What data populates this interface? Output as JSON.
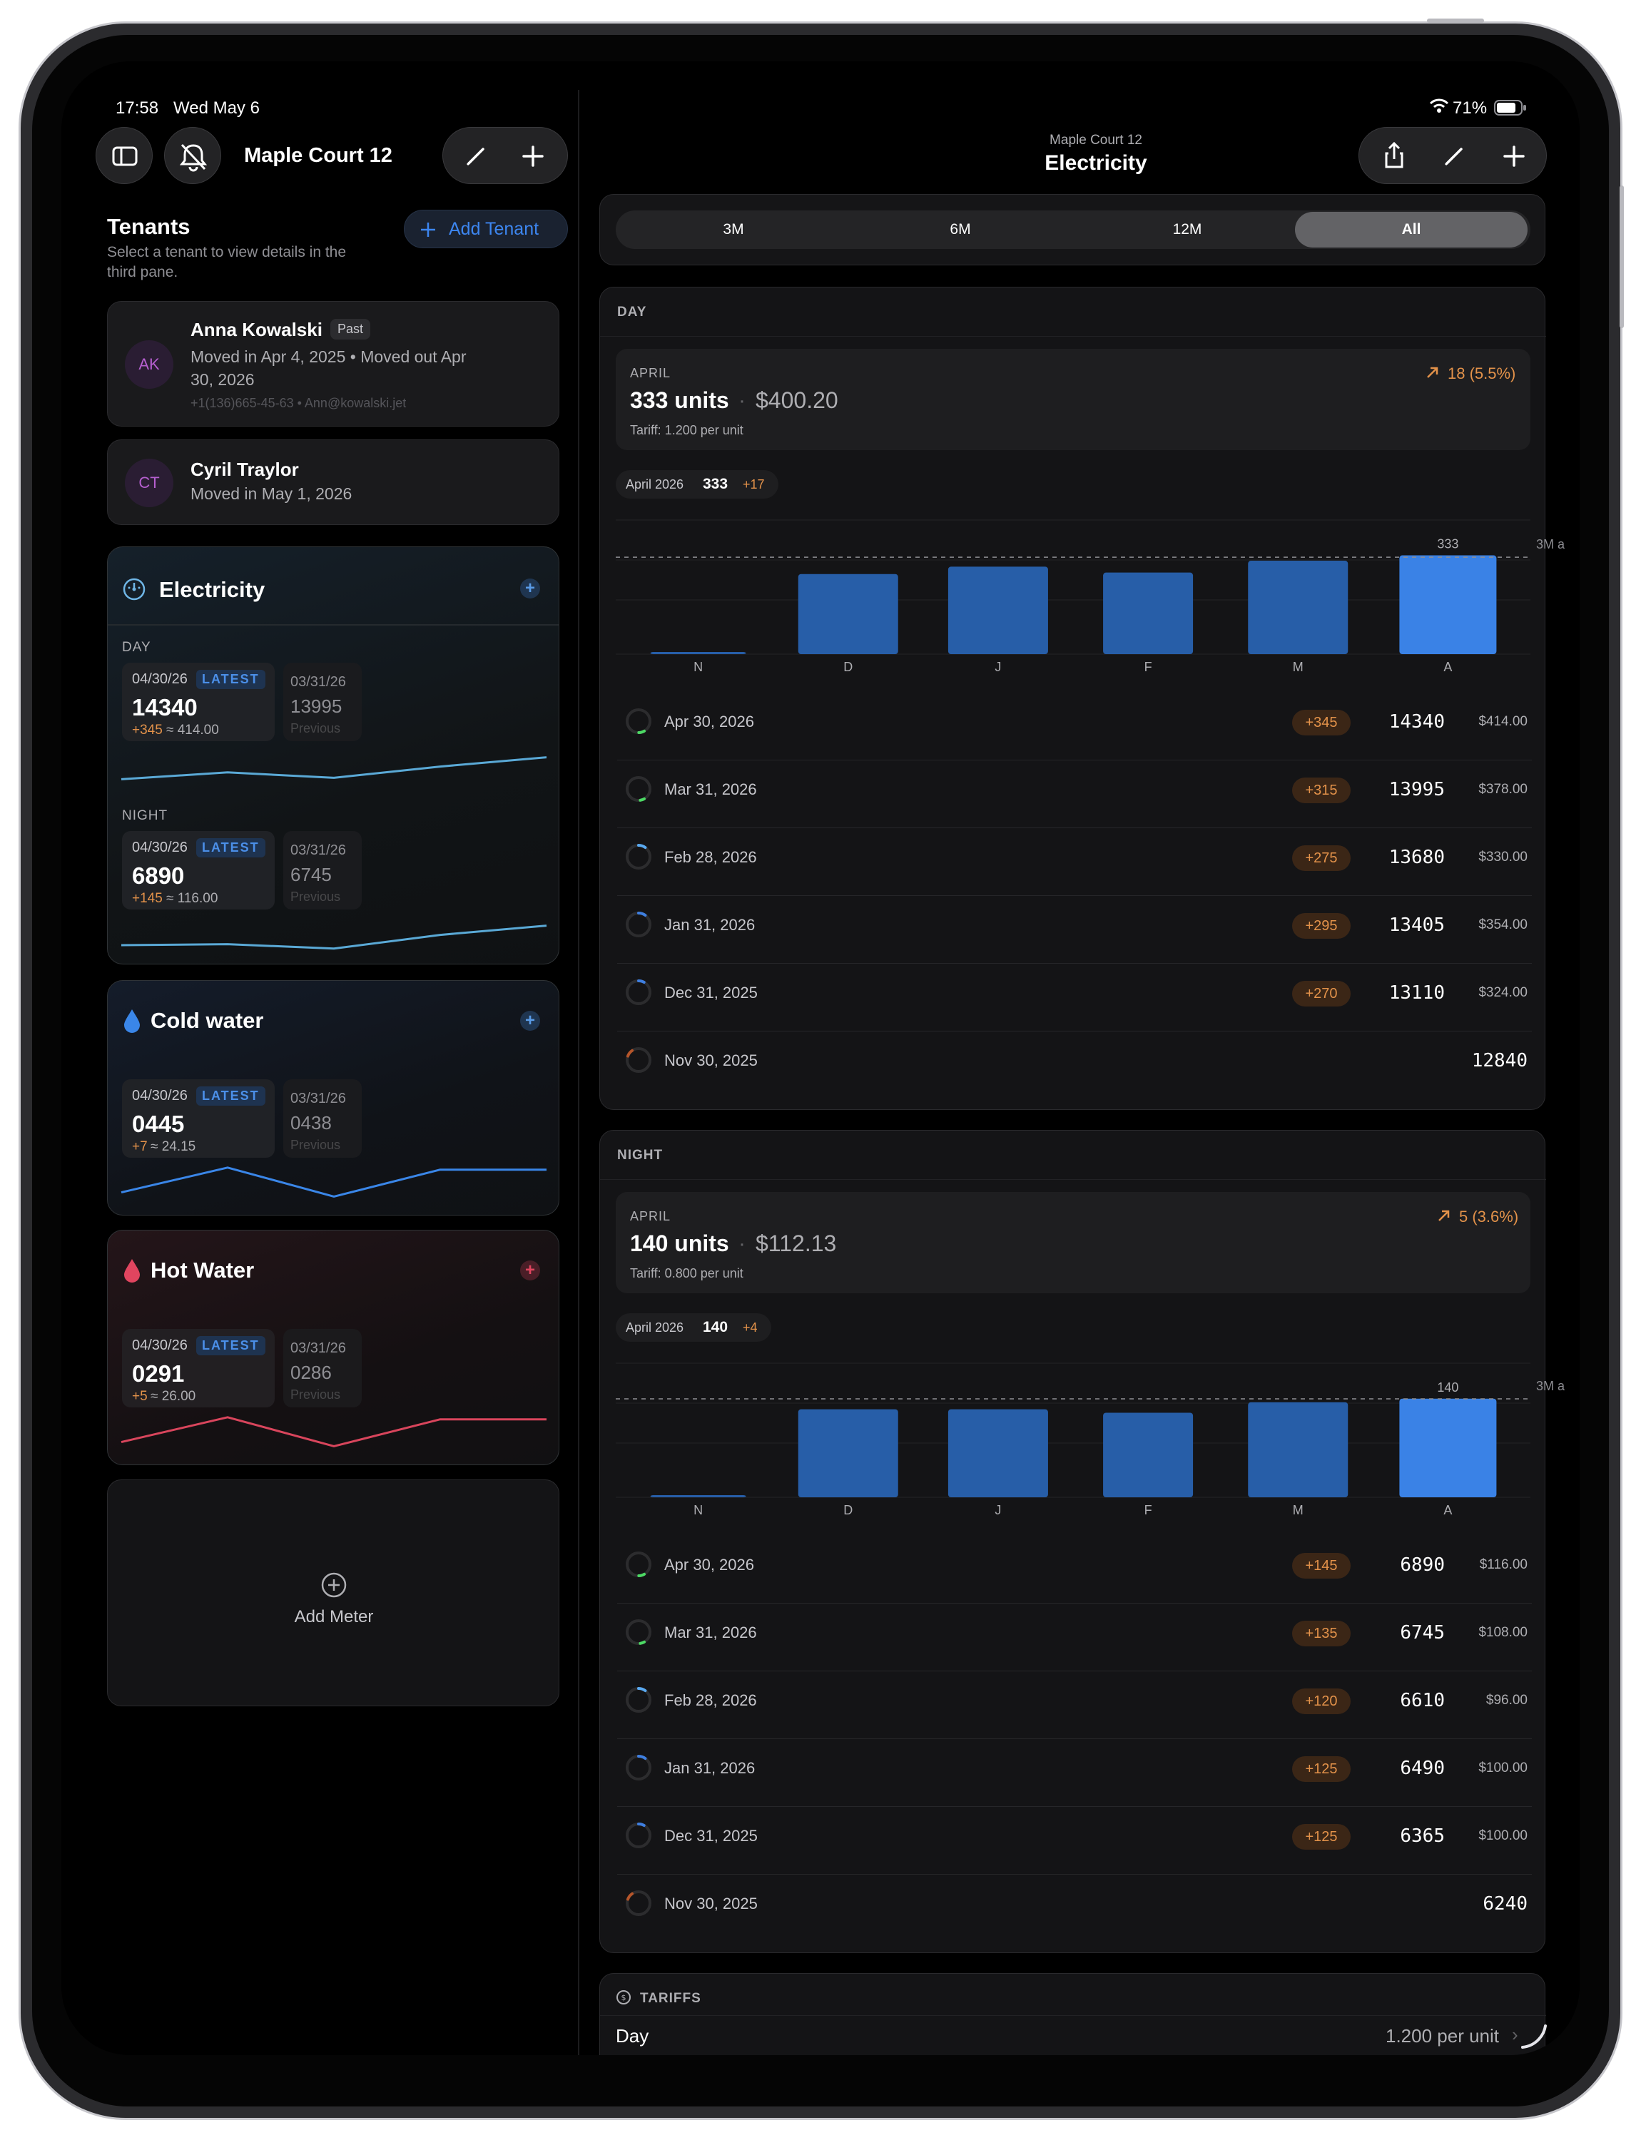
{
  "status_bar": {
    "time": "17:58",
    "date": "Wed May 6",
    "battery": "71%"
  },
  "left_toolbar": {
    "title": "Maple Court 12"
  },
  "tenants": {
    "heading": "Tenants",
    "subtitle_line1": "Select a tenant to view details in the",
    "subtitle_line2": "third pane.",
    "add_label": "Add Tenant",
    "items": [
      {
        "initials": "AK",
        "name": "Anna Kowalski",
        "badge": "Past",
        "line1": "Moved in Apr 4, 2025 • Moved out Apr",
        "line2": "30, 2026",
        "contact": "+1(136)665-45-63 • Ann@kowalski.jet"
      },
      {
        "initials": "CT",
        "name": "Cyril Traylor",
        "line1": "Moved in May 1, 2026"
      }
    ]
  },
  "meters": {
    "electricity": {
      "title": "Electricity",
      "day": {
        "label": "DAY",
        "latest_date": "04/30/26",
        "latest_tag": "LATEST",
        "latest_value": "14340",
        "latest_delta": "+345",
        "latest_cost": "≈ 414.00",
        "prev_date": "03/31/26",
        "prev_value": "13995",
        "prev_label": "Previous"
      },
      "night": {
        "label": "NIGHT",
        "latest_date": "04/30/26",
        "latest_tag": "LATEST",
        "latest_value": "6890",
        "latest_delta": "+145",
        "latest_cost": "≈ 116.00",
        "prev_date": "03/31/26",
        "prev_value": "6745",
        "prev_label": "Previous"
      }
    },
    "cold_water": {
      "title": "Cold water",
      "latest_date": "04/30/26",
      "latest_tag": "LATEST",
      "latest_value": "0445",
      "latest_delta": "+7",
      "latest_cost": "≈ 24.15",
      "prev_date": "03/31/26",
      "prev_value": "0438",
      "prev_label": "Previous"
    },
    "hot_water": {
      "title": "Hot Water",
      "latest_date": "04/30/26",
      "latest_tag": "LATEST",
      "latest_value": "0291",
      "latest_delta": "+5",
      "latest_cost": "≈ 26.00",
      "prev_date": "03/31/26",
      "prev_value": "0286",
      "prev_label": "Previous"
    },
    "add_meter_label": "Add Meter"
  },
  "detail_header": {
    "subtitle": "Maple Court 12",
    "title": "Electricity"
  },
  "range_selector": {
    "options": [
      "3M",
      "6M",
      "12M",
      "All"
    ],
    "selected": "All"
  },
  "day_section": {
    "label": "DAY",
    "summary": {
      "month": "APRIL",
      "units": "333 units",
      "dot": "·",
      "cost": "$400.20",
      "tariff": "Tariff: 1.200 per unit",
      "trend": "18 (5.5%)"
    },
    "chip": {
      "period": "April 2026",
      "value": "333",
      "delta": "+17"
    },
    "avg_label": "3M a",
    "rows": [
      {
        "date": "Apr 30, 2026",
        "delta": "+345",
        "value": "14340",
        "cost": "$414.00",
        "ring": 0.08,
        "ring_color": "#4cd964"
      },
      {
        "date": "Mar 31, 2026",
        "delta": "+315",
        "value": "13995",
        "cost": "$378.00",
        "ring": 0.06,
        "ring_color": "#4cd964"
      },
      {
        "date": "Feb 28, 2026",
        "delta": "+275",
        "value": "13680",
        "cost": "$330.00",
        "ring": 0.1,
        "ring_color": "#5aa9f0"
      },
      {
        "date": "Jan 31, 2026",
        "delta": "+295",
        "value": "13405",
        "cost": "$354.00",
        "ring": 0.1,
        "ring_color": "#3f7fe0"
      },
      {
        "date": "Dec 31, 2025",
        "delta": "+270",
        "value": "13110",
        "cost": "$324.00",
        "ring": 0.08,
        "ring_color": "#3f7fe0"
      },
      {
        "date": "Nov 30, 2025",
        "value": "12840",
        "ring": 0.1,
        "ring_color": "#b5552a"
      }
    ]
  },
  "night_section": {
    "label": "NIGHT",
    "summary": {
      "month": "APRIL",
      "units": "140 units",
      "dot": "·",
      "cost": "$112.13",
      "tariff": "Tariff: 0.800 per unit",
      "trend": "5 (3.6%)"
    },
    "chip": {
      "period": "April 2026",
      "value": "140",
      "delta": "+4"
    },
    "avg_label": "3M a",
    "rows": [
      {
        "date": "Apr 30, 2026",
        "delta": "+145",
        "value": "6890",
        "cost": "$116.00",
        "ring": 0.08,
        "ring_color": "#4cd964"
      },
      {
        "date": "Mar 31, 2026",
        "delta": "+135",
        "value": "6745",
        "cost": "$108.00",
        "ring": 0.06,
        "ring_color": "#4cd964"
      },
      {
        "date": "Feb 28, 2026",
        "delta": "+120",
        "value": "6610",
        "cost": "$96.00",
        "ring": 0.1,
        "ring_color": "#5aa9f0"
      },
      {
        "date": "Jan 31, 2026",
        "delta": "+125",
        "value": "6490",
        "cost": "$100.00",
        "ring": 0.1,
        "ring_color": "#3f7fe0"
      },
      {
        "date": "Dec 31, 2025",
        "delta": "+125",
        "value": "6365",
        "cost": "$100.00",
        "ring": 0.08,
        "ring_color": "#3f7fe0"
      },
      {
        "date": "Nov 30, 2025",
        "value": "6240",
        "ring": 0.1,
        "ring_color": "#b5552a"
      }
    ]
  },
  "tariffs": {
    "heading": "TARIFFS",
    "row_label": "Day",
    "row_value": "1.200 per unit"
  },
  "colors": {
    "accent": "#3478f6",
    "delta_orange": "#e3924a",
    "cold_line": "#3a86e8",
    "hot_line": "#d9455c",
    "elec_line": "#5aa9d6"
  },
  "chart_data": [
    {
      "type": "bar",
      "title": "",
      "categories": [
        "N",
        "D",
        "J",
        "F",
        "M",
        "A"
      ],
      "values": [
        3,
        270,
        295,
        275,
        315,
        333
      ],
      "data_labels": {
        "A": "333"
      },
      "reference_line": {
        "label": "3M a"
      },
      "ylim": [
        0,
        380
      ],
      "grid": true
    },
    {
      "type": "bar",
      "title": "",
      "categories": [
        "N",
        "D",
        "J",
        "F",
        "M",
        "A"
      ],
      "values": [
        3,
        125,
        125,
        120,
        135,
        140
      ],
      "data_labels": {
        "A": "140"
      },
      "reference_line": {
        "label": "3M a"
      },
      "ylim": [
        0,
        160
      ],
      "grid": true
    }
  ],
  "sparklines": {
    "electricity_day": [
      0.18,
      0.38,
      0.22,
      0.55,
      0.82
    ],
    "electricity_night": [
      0.25,
      0.28,
      0.15,
      0.55,
      0.82
    ],
    "cold_water": [
      0.3,
      0.9,
      0.2,
      0.85,
      0.85
    ],
    "hot_water": [
      0.3,
      0.9,
      0.2,
      0.85,
      0.85
    ]
  }
}
